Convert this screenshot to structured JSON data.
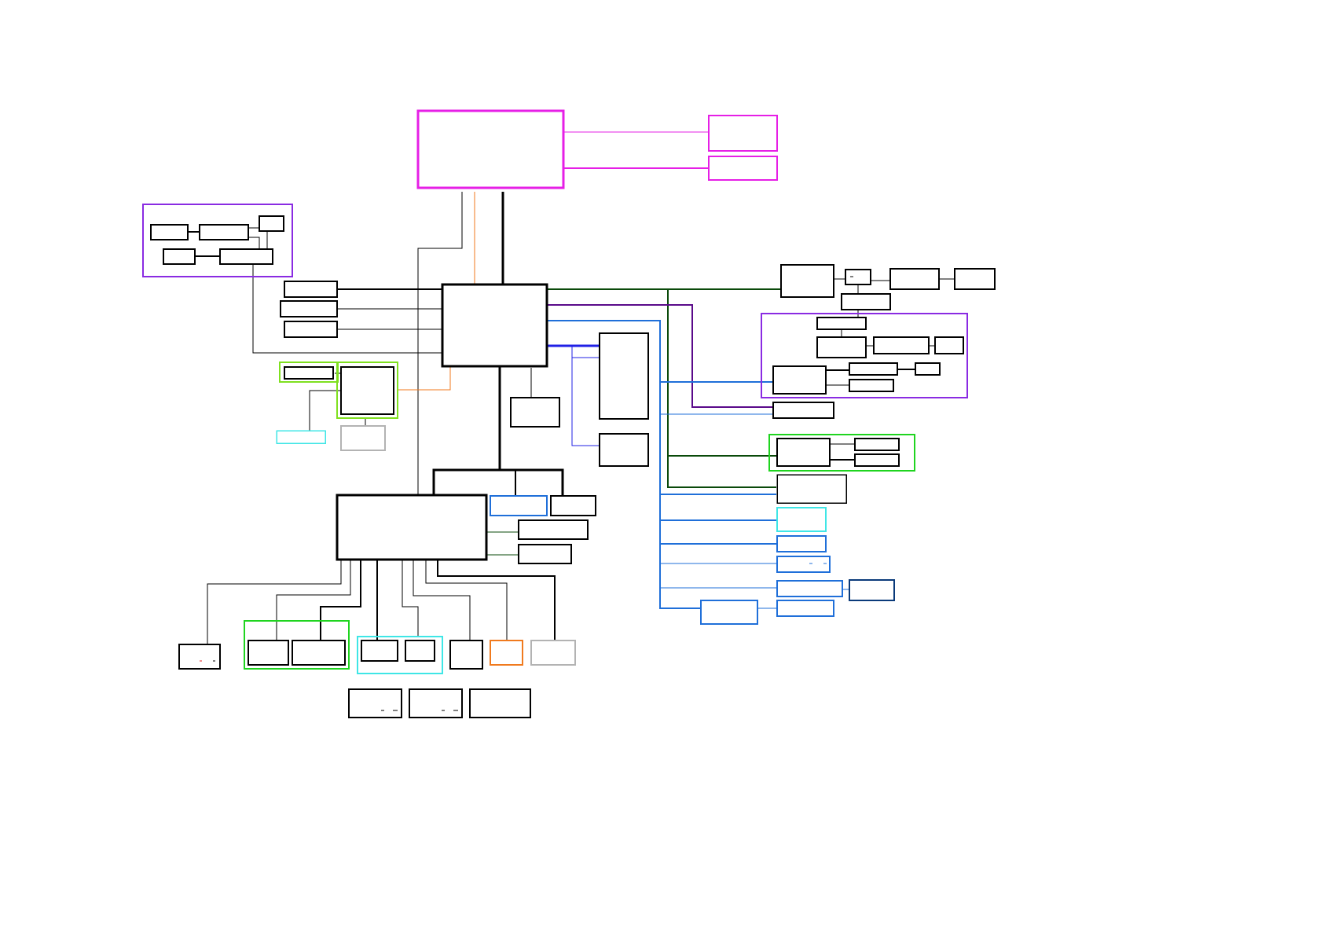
{
  "diagram": {
    "background": "#ffffff",
    "colors": {
      "black": "#000000",
      "magenta": "#e61fe6",
      "purple": "#8a2be2",
      "orange": "#f07a1e",
      "green": "#1fd41f",
      "light_green": "#7fe01f",
      "dark_green": "#0a4a0a",
      "blue": "#1f6fd9",
      "royal_blue": "#2020e6",
      "cyan": "#3fe6e6",
      "gray": "#b3b3b3",
      "violet_wire": "#5a0a8a",
      "navy": "#0a3a7a"
    },
    "labels": {}
  }
}
